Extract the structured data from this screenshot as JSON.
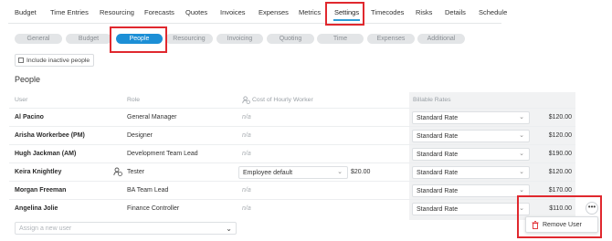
{
  "top_tabs": [
    {
      "label": "Budget"
    },
    {
      "label": "Time Entries"
    },
    {
      "label": "Resourcing"
    },
    {
      "label": "Forecasts"
    },
    {
      "label": "Quotes"
    },
    {
      "label": "Invoices"
    },
    {
      "label": "Expenses"
    },
    {
      "label": "Metrics"
    },
    {
      "label": "Settings",
      "active": true
    },
    {
      "label": "Timecodes"
    },
    {
      "label": "Risks"
    },
    {
      "label": "Details"
    },
    {
      "label": "Schedule"
    }
  ],
  "sub_tabs": [
    {
      "label": "General"
    },
    {
      "label": "Budget"
    },
    {
      "label": "People",
      "active": true
    },
    {
      "label": "Resourcing"
    },
    {
      "label": "Invoicing"
    },
    {
      "label": "Quoting"
    },
    {
      "label": "Time"
    },
    {
      "label": "Expenses"
    },
    {
      "label": "Additional"
    }
  ],
  "include_inactive": {
    "label": "Include inactive people",
    "checked": false
  },
  "section_title": "People",
  "table": {
    "headers": {
      "user": "User",
      "role": "Role",
      "cost": "Cost of Hourly Worker",
      "billable": "Billable Rates"
    },
    "rows": [
      {
        "name": "Al Pacino",
        "role": "General Manager",
        "cost": "n/a",
        "rate": "Standard Rate",
        "amount": "$120.00"
      },
      {
        "name": "Arisha Workerbee (PM)",
        "role": "Designer",
        "cost": "n/a",
        "rate": "Standard Rate",
        "amount": "$120.00"
      },
      {
        "name": "Hugh Jackman (AM)",
        "role": "Development Team Lead",
        "cost": "n/a",
        "rate": "Standard Rate",
        "amount": "$190.00"
      },
      {
        "name": "Keira Knightley",
        "role": "Tester",
        "cost_select": "Employee default",
        "cost_amount": "$20.00",
        "rate": "Standard Rate",
        "amount": "$120.00",
        "hourly_worker": true
      },
      {
        "name": "Morgan Freeman",
        "role": "BA Team Lead",
        "cost": "n/a",
        "rate": "Standard Rate",
        "amount": "$170.00"
      },
      {
        "name": "Angelina Jolie",
        "role": "Finance Controller",
        "cost": "n/a",
        "rate": "Standard Rate",
        "amount": "$110.00"
      }
    ]
  },
  "assign": {
    "placeholder": "Assign a new user"
  },
  "row_menu": {
    "remove_label": "Remove User"
  },
  "icons": {
    "more": "more-horizontal-icon",
    "trash": "trash-icon",
    "worker": "hourly-worker-icon",
    "chevron": "chevron-down-icon"
  },
  "colors": {
    "accent": "#1c8fd6",
    "tab_underline": "#2c9bd6",
    "highlight": "#e0282e",
    "danger": "#e0282e"
  }
}
